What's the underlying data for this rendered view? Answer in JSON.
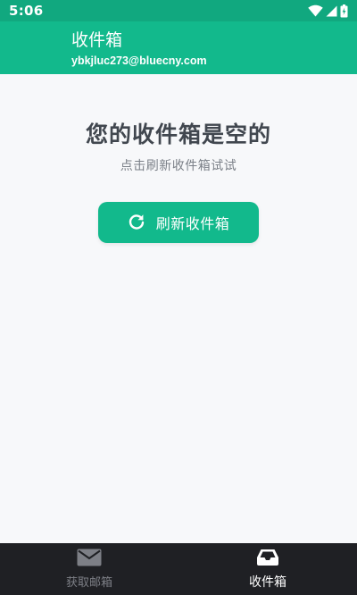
{
  "status_bar": {
    "time": "5:06",
    "icons": [
      "wifi-icon",
      "signal-icon",
      "battery-icon"
    ]
  },
  "app_bar": {
    "title": "收件箱",
    "email": "ybkjluc273@bluecny.com"
  },
  "empty_state": {
    "title": "您的收件箱是空的",
    "hint": "点击刷新收件箱试试",
    "refresh_label": "刷新收件箱",
    "refresh_icon": "refresh-icon"
  },
  "bottom_nav": {
    "items": [
      {
        "label": "获取邮箱",
        "icon": "mail-icon",
        "active": false
      },
      {
        "label": "收件箱",
        "icon": "inbox-icon",
        "active": true
      }
    ]
  },
  "colors": {
    "accent": "#12b98c",
    "status_bar": "#11a87f",
    "nav_background": "#1f2024",
    "background": "#f7f8fa"
  }
}
